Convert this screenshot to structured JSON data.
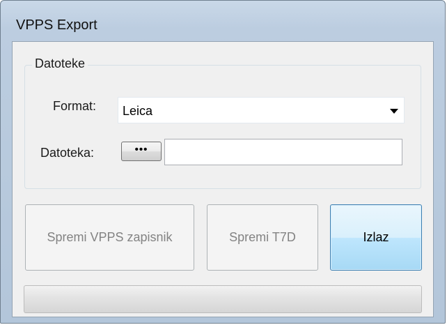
{
  "window": {
    "title": "VPPS Export"
  },
  "files_group": {
    "legend": "Datoteke",
    "format": {
      "label": "Format:",
      "selected": "Leica"
    },
    "file": {
      "label": "Datoteka:",
      "browse_label": "•••",
      "value": ""
    }
  },
  "actions": {
    "save_vpps_label": "Spremi VPPS zapisnik",
    "save_t7d_label": "Spremi T7D",
    "exit_label": "Izlaz"
  },
  "progress": {
    "value": 0
  },
  "colors": {
    "disabled_text": "#838383",
    "default_button_border": "#3c7fb1"
  }
}
